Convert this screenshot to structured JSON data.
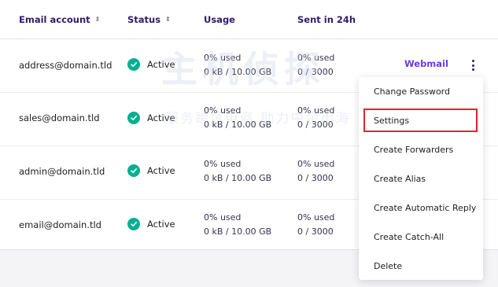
{
  "table": {
    "columns": [
      {
        "label": "Email account",
        "sortable": true
      },
      {
        "label": "Status",
        "sortable": true
      },
      {
        "label": "Usage",
        "sortable": false
      },
      {
        "label": "Sent in 24h",
        "sortable": false
      }
    ],
    "sort_icon": "⇕",
    "rows": [
      {
        "email": "address@domain.tld",
        "status": "Active",
        "usage_pct": "0% used",
        "usage_size": "0 kB / 10.00 GB",
        "sent_pct": "0% used",
        "sent_count": "0 / 3000",
        "webmail": "Webmail"
      },
      {
        "email": "sales@domain.tld",
        "status": "Active",
        "usage_pct": "0% used",
        "usage_size": "0 kB / 10.00 GB",
        "sent_pct": "0% used",
        "sent_count": "0 / 3000"
      },
      {
        "email": "admin@domain.tld",
        "status": "Active",
        "usage_pct": "0% used",
        "usage_size": "0 kB / 10.00 GB",
        "sent_pct": "0% used",
        "sent_count": "0 / 3000"
      },
      {
        "email": "email@domain.tld",
        "status": "Active",
        "usage_pct": "0% used",
        "usage_size": "0 kB / 10.00 GB",
        "sent_pct": "0% used",
        "sent_count": "0 / 3000"
      }
    ]
  },
  "menu": {
    "items": [
      "Change Password",
      "Settings",
      "Create Forwarders",
      "Create Alias",
      "Create Automatic Reply",
      "Create Catch-All",
      "Delete"
    ],
    "highlighted": "Settings"
  },
  "watermark": {
    "brand": "主机侦探",
    "tagline": "服务跨境电商 助力中企出海"
  },
  "colors": {
    "accent": "#673de6",
    "active": "#00b090",
    "highlight_border": "#e0242b",
    "header_text": "#2f1c6a"
  },
  "icons": {
    "status": "check-circle-icon",
    "more": "kebab-menu-icon",
    "sort": "sort-icon"
  }
}
